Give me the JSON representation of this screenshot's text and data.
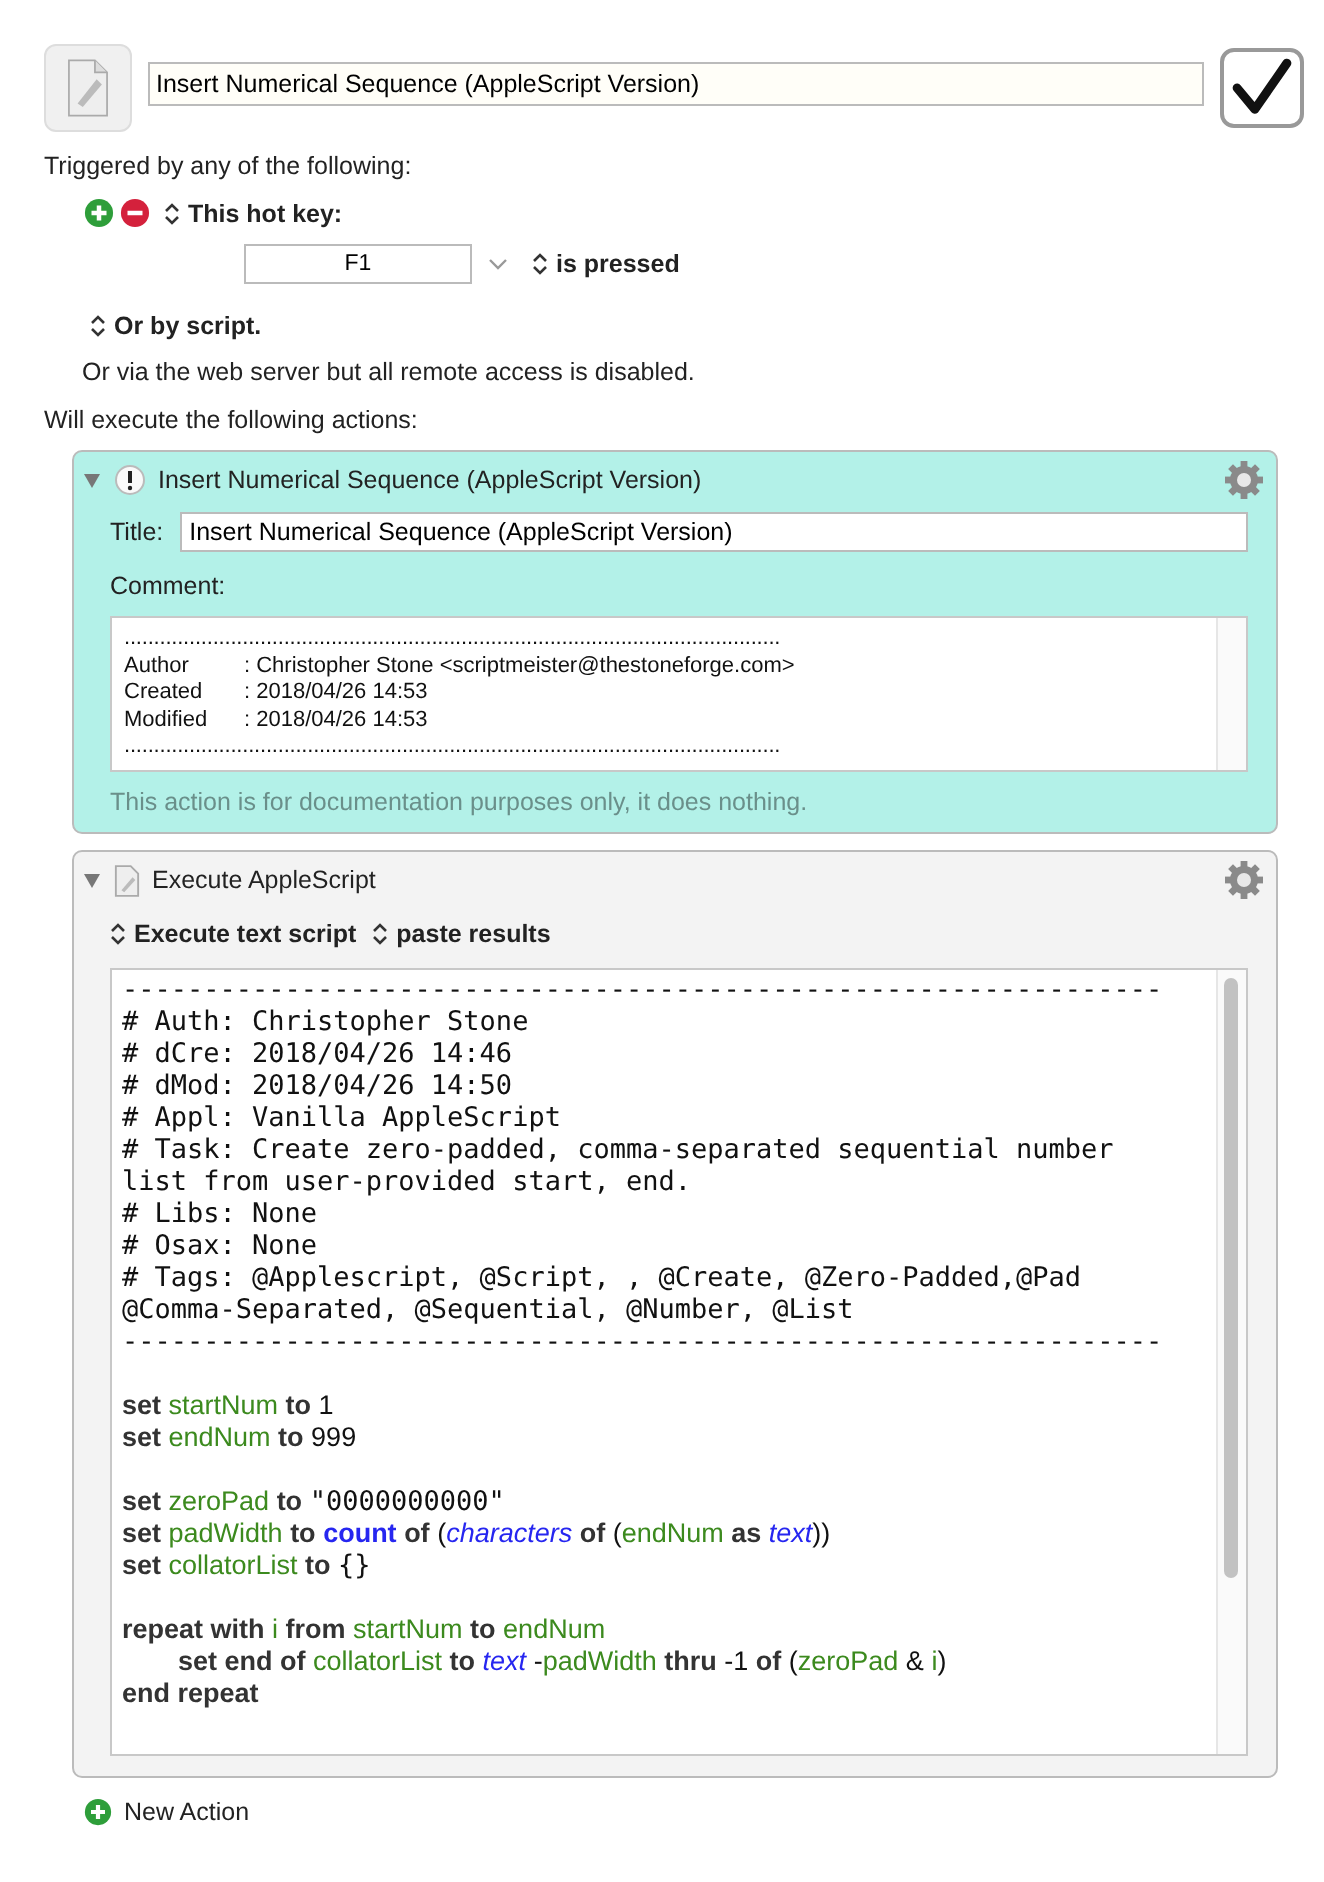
{
  "macro": {
    "name": "Insert Numerical Sequence (AppleScript Version)",
    "enabled": true
  },
  "triggers": {
    "heading": "Triggered by any of the following:",
    "items": [
      {
        "kind": "hotkey",
        "label": "This hot key:",
        "key": "F1",
        "condition": "is pressed"
      }
    ],
    "script_trigger": "Or by script.",
    "web_note": "Or via the web server but all remote access is disabled."
  },
  "actions_heading": "Will execute the following actions:",
  "actions": [
    {
      "kind": "comment",
      "expanded": true,
      "title": "Insert Numerical Sequence (AppleScript Version)",
      "title_label": "Title:",
      "title_value": "Insert Numerical Sequence (AppleScript Version)",
      "comment_label": "Comment:",
      "comment_lines": [
        {
          "kind": "rule",
          "text": "..............................................................................................................."
        },
        {
          "kind": "field",
          "label": "Author",
          "value": ":  Christopher Stone <scriptmeister@thestoneforge.com>"
        },
        {
          "kind": "field",
          "label": "Created",
          "value": ":  2018/04/26 14:53"
        },
        {
          "kind": "field",
          "label": "Modified",
          "value": ":  2018/04/26 14:53"
        },
        {
          "kind": "rule",
          "text": "..............................................................................................................."
        }
      ],
      "note": "This action is for documentation purposes only, it does nothing."
    },
    {
      "kind": "applescript",
      "expanded": true,
      "title": "Execute AppleScript",
      "options": [
        "Execute text script",
        "paste results"
      ],
      "script_blocks": [
        [
          {
            "indented": false,
            "tokens": [
              {
                "kind": "mono",
                "text": "----------------------------------------------------------------"
              }
            ]
          },
          {
            "indented": false,
            "tokens": [
              {
                "kind": "mono",
                "text": "# Auth: Christopher Stone"
              }
            ]
          },
          {
            "indented": false,
            "tokens": [
              {
                "kind": "mono",
                "text": "# dCre: 2018/04/26 14:46"
              }
            ]
          },
          {
            "indented": false,
            "tokens": [
              {
                "kind": "mono",
                "text": "# dMod: 2018/04/26 14:50"
              }
            ]
          },
          {
            "indented": false,
            "tokens": [
              {
                "kind": "mono",
                "text": "# Appl: Vanilla AppleScript"
              }
            ]
          },
          {
            "indented": false,
            "tokens": [
              {
                "kind": "mono",
                "text": "# Task: Create zero-padded, comma-separated sequential number"
              }
            ]
          },
          {
            "indented": false,
            "tokens": [
              {
                "kind": "mono",
                "text": "list from user-provided start, end."
              }
            ]
          },
          {
            "indented": false,
            "tokens": [
              {
                "kind": "mono",
                "text": "# Libs: None"
              }
            ]
          },
          {
            "indented": false,
            "tokens": [
              {
                "kind": "mono",
                "text": "# Osax: None"
              }
            ]
          },
          {
            "indented": false,
            "tokens": [
              {
                "kind": "mono",
                "text": "# Tags: @Applescript, @Script, , @Create, @Zero-Padded,@Pad"
              }
            ]
          },
          {
            "indented": false,
            "tokens": [
              {
                "kind": "mono",
                "text": "@Comma-Separated, @Sequential, @Number, @List"
              }
            ]
          },
          {
            "indented": false,
            "tokens": [
              {
                "kind": "mono",
                "text": "----------------------------------------------------------------"
              }
            ]
          }
        ],
        [
          {
            "indented": false,
            "tokens": [
              {
                "kind": "keyword",
                "text": "set "
              },
              {
                "kind": "variable",
                "text": "startNum"
              },
              {
                "kind": "keyword",
                "text": " to "
              },
              {
                "kind": "plain",
                "text": "1"
              }
            ]
          },
          {
            "indented": false,
            "tokens": [
              {
                "kind": "keyword",
                "text": "set "
              },
              {
                "kind": "variable",
                "text": "endNum"
              },
              {
                "kind": "keyword",
                "text": " to "
              },
              {
                "kind": "plain",
                "text": "999"
              }
            ]
          }
        ],
        [
          {
            "indented": false,
            "tokens": [
              {
                "kind": "keyword",
                "text": "set "
              },
              {
                "kind": "variable",
                "text": "zeroPad"
              },
              {
                "kind": "keyword",
                "text": " to "
              },
              {
                "kind": "mono",
                "text": "\"0000000000\""
              }
            ]
          },
          {
            "indented": false,
            "tokens": [
              {
                "kind": "keyword",
                "text": "set "
              },
              {
                "kind": "variable",
                "text": "padWidth"
              },
              {
                "kind": "keyword",
                "text": " to "
              },
              {
                "kind": "command",
                "text": "count"
              },
              {
                "kind": "keyword",
                "text": " of "
              },
              {
                "kind": "plain",
                "text": "("
              },
              {
                "kind": "class",
                "text": "characters"
              },
              {
                "kind": "keyword",
                "text": " of "
              },
              {
                "kind": "plain",
                "text": "("
              },
              {
                "kind": "variable",
                "text": "endNum"
              },
              {
                "kind": "keyword",
                "text": " as "
              },
              {
                "kind": "class",
                "text": "text"
              },
              {
                "kind": "plain",
                "text": "))"
              }
            ]
          },
          {
            "indented": false,
            "tokens": [
              {
                "kind": "keyword",
                "text": "set "
              },
              {
                "kind": "variable",
                "text": "collatorList"
              },
              {
                "kind": "keyword",
                "text": " to "
              },
              {
                "kind": "mono",
                "text": "{}"
              }
            ]
          }
        ],
        [
          {
            "indented": false,
            "tokens": [
              {
                "kind": "keyword",
                "text": "repeat with "
              },
              {
                "kind": "variable",
                "text": "i"
              },
              {
                "kind": "keyword",
                "text": " from "
              },
              {
                "kind": "variable",
                "text": "startNum"
              },
              {
                "kind": "keyword",
                "text": " to "
              },
              {
                "kind": "variable",
                "text": "endNum"
              }
            ]
          },
          {
            "indented": true,
            "tokens": [
              {
                "kind": "keyword",
                "text": "set end of "
              },
              {
                "kind": "variable",
                "text": "collatorList"
              },
              {
                "kind": "keyword",
                "text": " to "
              },
              {
                "kind": "class",
                "text": "text"
              },
              {
                "kind": "plain",
                "text": " -"
              },
              {
                "kind": "variable",
                "text": "padWidth"
              },
              {
                "kind": "keyword",
                "text": " thru "
              },
              {
                "kind": "plain",
                "text": "-1"
              },
              {
                "kind": "keyword",
                "text": " of "
              },
              {
                "kind": "plain",
                "text": "("
              },
              {
                "kind": "variable",
                "text": "zeroPad"
              },
              {
                "kind": "plain",
                "text": " & "
              },
              {
                "kind": "variable",
                "text": "i"
              },
              {
                "kind": "plain",
                "text": ")"
              }
            ]
          },
          {
            "indented": false,
            "tokens": [
              {
                "kind": "keyword",
                "text": "end repeat"
              }
            ]
          }
        ]
      ]
    }
  ],
  "new_action": "New Action"
}
